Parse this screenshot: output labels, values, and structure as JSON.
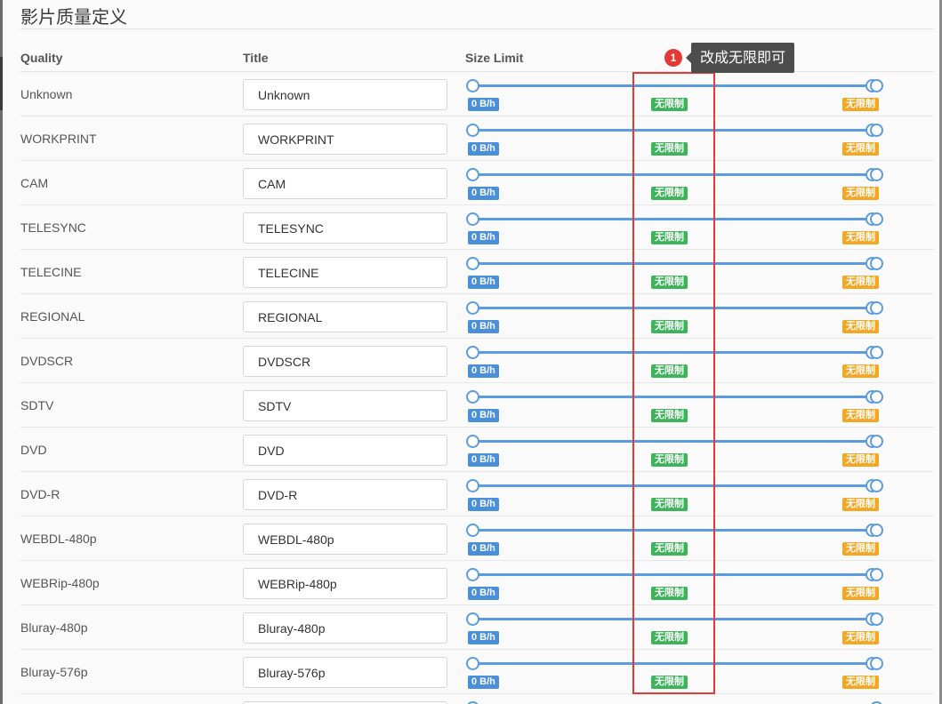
{
  "section": {
    "title": "影片质量定义"
  },
  "table": {
    "headers": {
      "quality": "Quality",
      "title": "Title",
      "size_limit": "Size Limit"
    },
    "rows": [
      {
        "quality": "Unknown",
        "title": "Unknown",
        "min_label": "0 B/h",
        "mid_label": "无限制",
        "max_label": "无限制"
      },
      {
        "quality": "WORKPRINT",
        "title": "WORKPRINT",
        "min_label": "0 B/h",
        "mid_label": "无限制",
        "max_label": "无限制"
      },
      {
        "quality": "CAM",
        "title": "CAM",
        "min_label": "0 B/h",
        "mid_label": "无限制",
        "max_label": "无限制"
      },
      {
        "quality": "TELESYNC",
        "title": "TELESYNC",
        "min_label": "0 B/h",
        "mid_label": "无限制",
        "max_label": "无限制"
      },
      {
        "quality": "TELECINE",
        "title": "TELECINE",
        "min_label": "0 B/h",
        "mid_label": "无限制",
        "max_label": "无限制"
      },
      {
        "quality": "REGIONAL",
        "title": "REGIONAL",
        "min_label": "0 B/h",
        "mid_label": "无限制",
        "max_label": "无限制"
      },
      {
        "quality": "DVDSCR",
        "title": "DVDSCR",
        "min_label": "0 B/h",
        "mid_label": "无限制",
        "max_label": "无限制"
      },
      {
        "quality": "SDTV",
        "title": "SDTV",
        "min_label": "0 B/h",
        "mid_label": "无限制",
        "max_label": "无限制"
      },
      {
        "quality": "DVD",
        "title": "DVD",
        "min_label": "0 B/h",
        "mid_label": "无限制",
        "max_label": "无限制"
      },
      {
        "quality": "DVD-R",
        "title": "DVD-R",
        "min_label": "0 B/h",
        "mid_label": "无限制",
        "max_label": "无限制"
      },
      {
        "quality": "WEBDL-480p",
        "title": "WEBDL-480p",
        "min_label": "0 B/h",
        "mid_label": "无限制",
        "max_label": "无限制"
      },
      {
        "quality": "WEBRip-480p",
        "title": "WEBRip-480p",
        "min_label": "0 B/h",
        "mid_label": "无限制",
        "max_label": "无限制"
      },
      {
        "quality": "Bluray-480p",
        "title": "Bluray-480p",
        "min_label": "0 B/h",
        "mid_label": "无限制",
        "max_label": "无限制"
      },
      {
        "quality": "Bluray-576p",
        "title": "Bluray-576p",
        "min_label": "0 B/h",
        "mid_label": "无限制",
        "max_label": "无限制"
      }
    ]
  },
  "annotation": {
    "number": "1",
    "text": "改成无限即可"
  },
  "colors": {
    "slider_blue": "#5b9be0",
    "badge_min": "#4a90d9",
    "badge_mid": "#3cb55a",
    "badge_max": "#f5a623",
    "highlight_red": "#e53935",
    "tooltip_bg": "#4d4d4d"
  }
}
